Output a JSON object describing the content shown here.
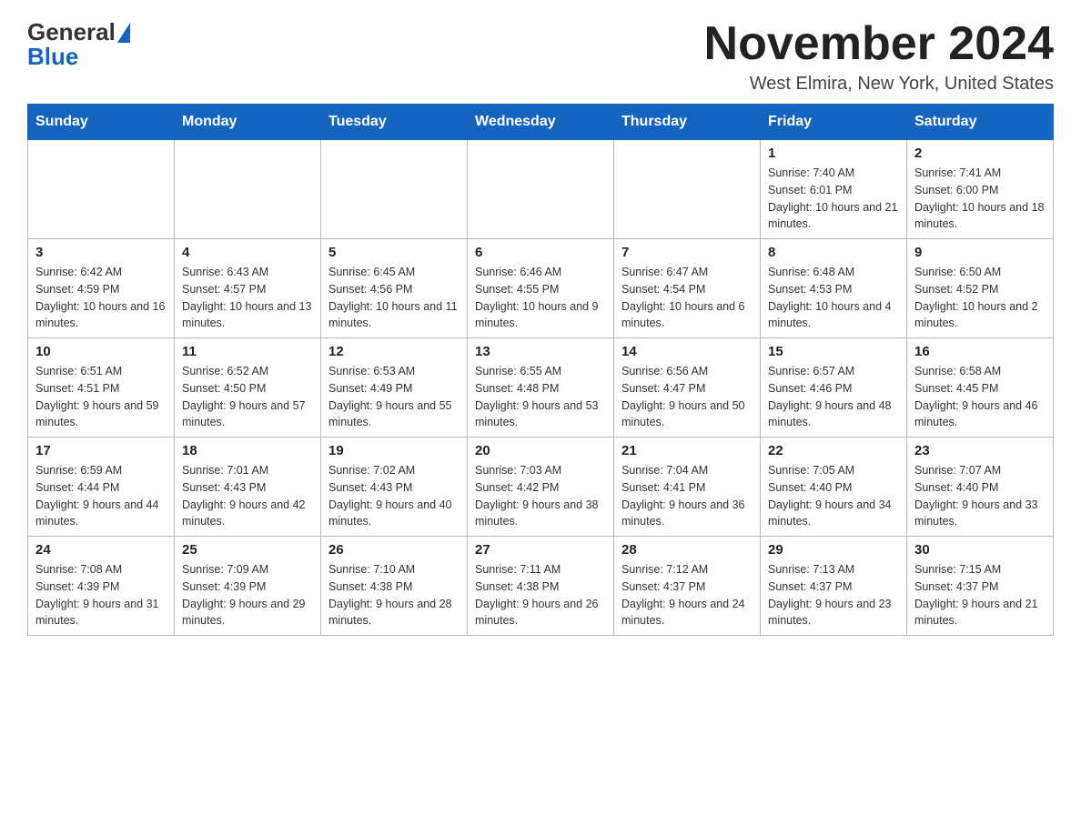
{
  "logo": {
    "general": "General",
    "blue": "Blue"
  },
  "title": "November 2024",
  "location": "West Elmira, New York, United States",
  "days_of_week": [
    "Sunday",
    "Monday",
    "Tuesday",
    "Wednesday",
    "Thursday",
    "Friday",
    "Saturday"
  ],
  "weeks": [
    [
      {
        "day": "",
        "sunrise": "",
        "sunset": "",
        "daylight": ""
      },
      {
        "day": "",
        "sunrise": "",
        "sunset": "",
        "daylight": ""
      },
      {
        "day": "",
        "sunrise": "",
        "sunset": "",
        "daylight": ""
      },
      {
        "day": "",
        "sunrise": "",
        "sunset": "",
        "daylight": ""
      },
      {
        "day": "",
        "sunrise": "",
        "sunset": "",
        "daylight": ""
      },
      {
        "day": "1",
        "sunrise": "Sunrise: 7:40 AM",
        "sunset": "Sunset: 6:01 PM",
        "daylight": "Daylight: 10 hours and 21 minutes."
      },
      {
        "day": "2",
        "sunrise": "Sunrise: 7:41 AM",
        "sunset": "Sunset: 6:00 PM",
        "daylight": "Daylight: 10 hours and 18 minutes."
      }
    ],
    [
      {
        "day": "3",
        "sunrise": "Sunrise: 6:42 AM",
        "sunset": "Sunset: 4:59 PM",
        "daylight": "Daylight: 10 hours and 16 minutes."
      },
      {
        "day": "4",
        "sunrise": "Sunrise: 6:43 AM",
        "sunset": "Sunset: 4:57 PM",
        "daylight": "Daylight: 10 hours and 13 minutes."
      },
      {
        "day": "5",
        "sunrise": "Sunrise: 6:45 AM",
        "sunset": "Sunset: 4:56 PM",
        "daylight": "Daylight: 10 hours and 11 minutes."
      },
      {
        "day": "6",
        "sunrise": "Sunrise: 6:46 AM",
        "sunset": "Sunset: 4:55 PM",
        "daylight": "Daylight: 10 hours and 9 minutes."
      },
      {
        "day": "7",
        "sunrise": "Sunrise: 6:47 AM",
        "sunset": "Sunset: 4:54 PM",
        "daylight": "Daylight: 10 hours and 6 minutes."
      },
      {
        "day": "8",
        "sunrise": "Sunrise: 6:48 AM",
        "sunset": "Sunset: 4:53 PM",
        "daylight": "Daylight: 10 hours and 4 minutes."
      },
      {
        "day": "9",
        "sunrise": "Sunrise: 6:50 AM",
        "sunset": "Sunset: 4:52 PM",
        "daylight": "Daylight: 10 hours and 2 minutes."
      }
    ],
    [
      {
        "day": "10",
        "sunrise": "Sunrise: 6:51 AM",
        "sunset": "Sunset: 4:51 PM",
        "daylight": "Daylight: 9 hours and 59 minutes."
      },
      {
        "day": "11",
        "sunrise": "Sunrise: 6:52 AM",
        "sunset": "Sunset: 4:50 PM",
        "daylight": "Daylight: 9 hours and 57 minutes."
      },
      {
        "day": "12",
        "sunrise": "Sunrise: 6:53 AM",
        "sunset": "Sunset: 4:49 PM",
        "daylight": "Daylight: 9 hours and 55 minutes."
      },
      {
        "day": "13",
        "sunrise": "Sunrise: 6:55 AM",
        "sunset": "Sunset: 4:48 PM",
        "daylight": "Daylight: 9 hours and 53 minutes."
      },
      {
        "day": "14",
        "sunrise": "Sunrise: 6:56 AM",
        "sunset": "Sunset: 4:47 PM",
        "daylight": "Daylight: 9 hours and 50 minutes."
      },
      {
        "day": "15",
        "sunrise": "Sunrise: 6:57 AM",
        "sunset": "Sunset: 4:46 PM",
        "daylight": "Daylight: 9 hours and 48 minutes."
      },
      {
        "day": "16",
        "sunrise": "Sunrise: 6:58 AM",
        "sunset": "Sunset: 4:45 PM",
        "daylight": "Daylight: 9 hours and 46 minutes."
      }
    ],
    [
      {
        "day": "17",
        "sunrise": "Sunrise: 6:59 AM",
        "sunset": "Sunset: 4:44 PM",
        "daylight": "Daylight: 9 hours and 44 minutes."
      },
      {
        "day": "18",
        "sunrise": "Sunrise: 7:01 AM",
        "sunset": "Sunset: 4:43 PM",
        "daylight": "Daylight: 9 hours and 42 minutes."
      },
      {
        "day": "19",
        "sunrise": "Sunrise: 7:02 AM",
        "sunset": "Sunset: 4:43 PM",
        "daylight": "Daylight: 9 hours and 40 minutes."
      },
      {
        "day": "20",
        "sunrise": "Sunrise: 7:03 AM",
        "sunset": "Sunset: 4:42 PM",
        "daylight": "Daylight: 9 hours and 38 minutes."
      },
      {
        "day": "21",
        "sunrise": "Sunrise: 7:04 AM",
        "sunset": "Sunset: 4:41 PM",
        "daylight": "Daylight: 9 hours and 36 minutes."
      },
      {
        "day": "22",
        "sunrise": "Sunrise: 7:05 AM",
        "sunset": "Sunset: 4:40 PM",
        "daylight": "Daylight: 9 hours and 34 minutes."
      },
      {
        "day": "23",
        "sunrise": "Sunrise: 7:07 AM",
        "sunset": "Sunset: 4:40 PM",
        "daylight": "Daylight: 9 hours and 33 minutes."
      }
    ],
    [
      {
        "day": "24",
        "sunrise": "Sunrise: 7:08 AM",
        "sunset": "Sunset: 4:39 PM",
        "daylight": "Daylight: 9 hours and 31 minutes."
      },
      {
        "day": "25",
        "sunrise": "Sunrise: 7:09 AM",
        "sunset": "Sunset: 4:39 PM",
        "daylight": "Daylight: 9 hours and 29 minutes."
      },
      {
        "day": "26",
        "sunrise": "Sunrise: 7:10 AM",
        "sunset": "Sunset: 4:38 PM",
        "daylight": "Daylight: 9 hours and 28 minutes."
      },
      {
        "day": "27",
        "sunrise": "Sunrise: 7:11 AM",
        "sunset": "Sunset: 4:38 PM",
        "daylight": "Daylight: 9 hours and 26 minutes."
      },
      {
        "day": "28",
        "sunrise": "Sunrise: 7:12 AM",
        "sunset": "Sunset: 4:37 PM",
        "daylight": "Daylight: 9 hours and 24 minutes."
      },
      {
        "day": "29",
        "sunrise": "Sunrise: 7:13 AM",
        "sunset": "Sunset: 4:37 PM",
        "daylight": "Daylight: 9 hours and 23 minutes."
      },
      {
        "day": "30",
        "sunrise": "Sunrise: 7:15 AM",
        "sunset": "Sunset: 4:37 PM",
        "daylight": "Daylight: 9 hours and 21 minutes."
      }
    ]
  ]
}
